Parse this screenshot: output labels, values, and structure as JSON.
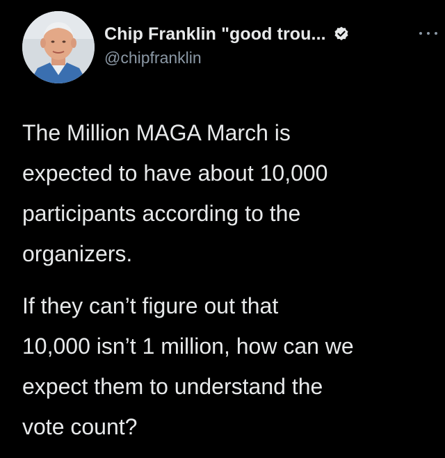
{
  "tweet": {
    "author": {
      "display_name": "Chip Franklin \"good trou...",
      "handle": "@chipfranklin",
      "verified": true,
      "avatar_icon": "person-photo-avatar"
    },
    "more_icon": "ellipsis-icon",
    "paragraphs": [
      "The Million MAGA March is\nexpected to have about 10,000\nparticipants according to the\norganizers.",
      "If they can’t figure out that\n10,000 isn’t 1 million, how can we\nexpect them to understand the\nvote count?"
    ]
  },
  "colors": {
    "background": "#000000",
    "text_primary": "#e7e9ea",
    "text_secondary": "#8b98a5",
    "verified_badge": "#e7e9ea"
  }
}
